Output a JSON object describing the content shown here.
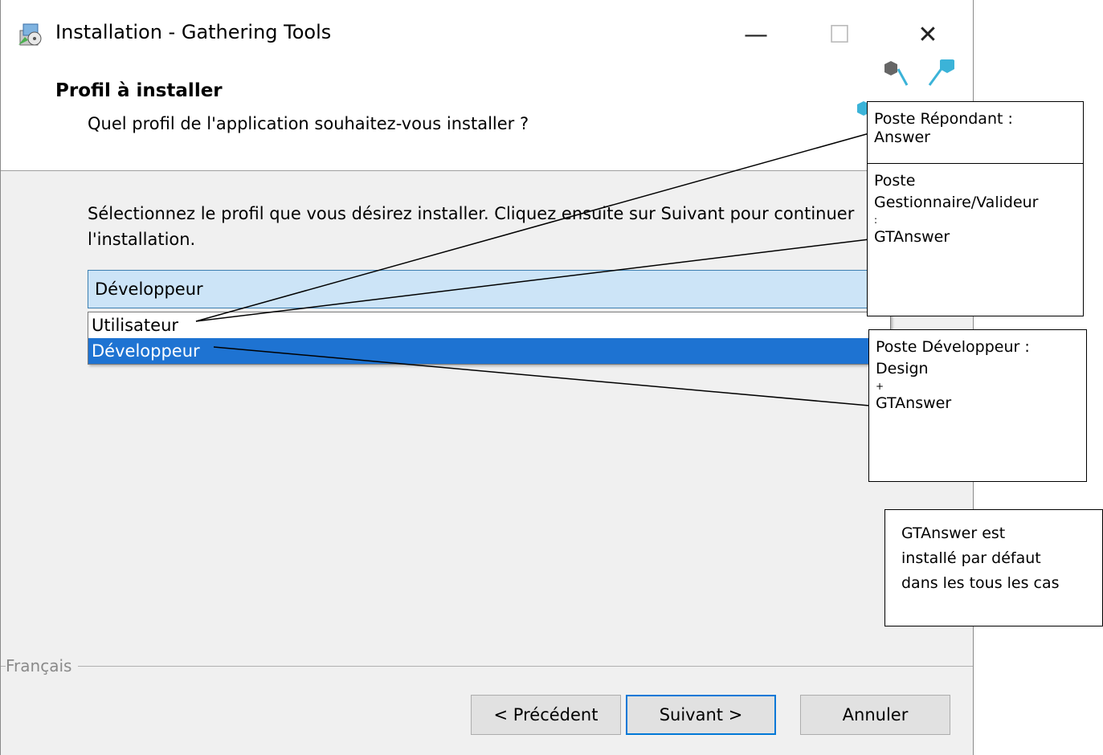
{
  "window": {
    "title": "Installation - Gathering Tools",
    "minimize_icon": "minimize-icon",
    "maximize_icon": "maximize-icon",
    "close_icon": "close-icon",
    "minimize_glyph": "—",
    "maximize_glyph": "☐",
    "close_glyph": "✕"
  },
  "header": {
    "title": "Profil à installer",
    "subtitle": "Quel profil de l'application souhaitez-vous installer ?"
  },
  "main": {
    "instruction": "Sélectionnez le profil que vous désirez installer. Cliquez ensuite sur Suivant pour continuer l'installation.",
    "combo_value": "Développeur",
    "options": [
      "Utilisateur",
      "Développeur"
    ],
    "selected_option": "Développeur"
  },
  "footer": {
    "language": "Français",
    "back_label": "< Précédent",
    "next_label": "Suivant >",
    "cancel_label": "Annuler"
  },
  "callouts": {
    "answer": {
      "line1": "Poste Répondant :",
      "line2": "Answer"
    },
    "gtanswer": {
      "line1": "Poste",
      "line2": "Gestionnaire/Valideur",
      "line3": ":",
      "line4": "GTAnswer"
    },
    "developer": {
      "line1": "Poste Développeur :",
      "line2": "Design",
      "line3": "+",
      "line4": "GTAnswer"
    },
    "note": {
      "line1": "GTAnswer est",
      "line2": "installé par défaut",
      "line3": "dans les tous les cas"
    }
  },
  "colors": {
    "selection": "#1e73d2",
    "combo_bg": "#cce4f7",
    "default_button_border": "#0078d7"
  }
}
